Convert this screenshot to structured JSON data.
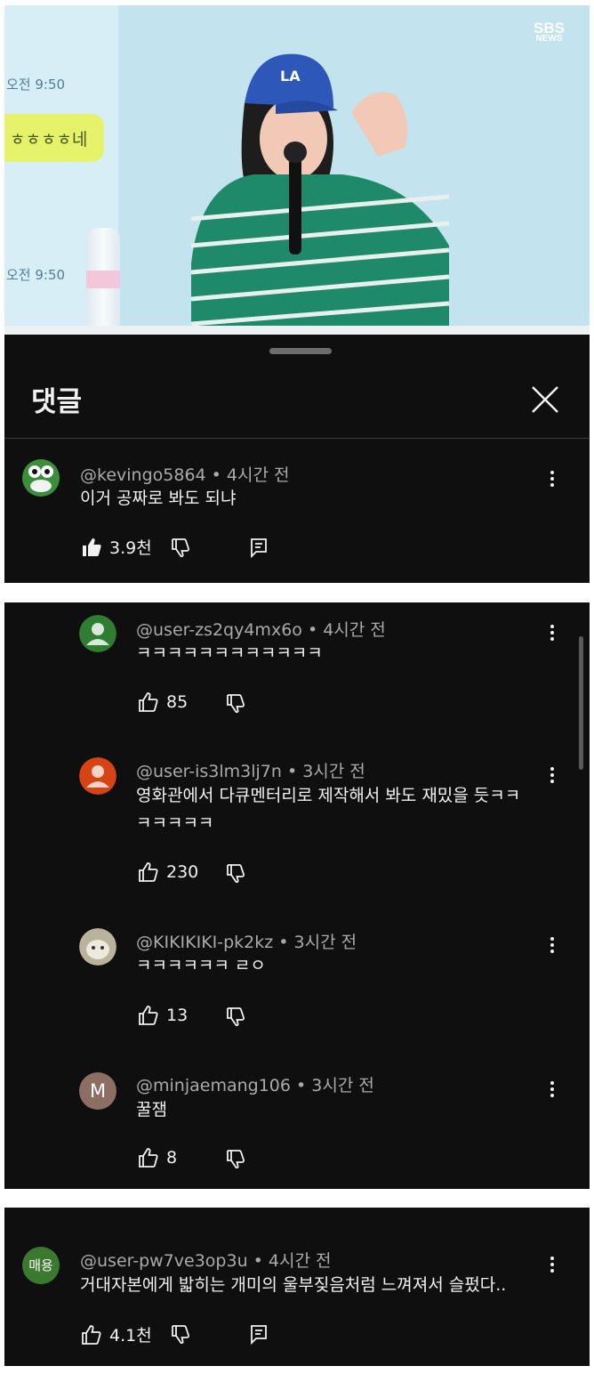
{
  "video": {
    "brand": "SBS",
    "brand_sub": "NEWS",
    "chat_time_1": "오전 9:50",
    "chat_bubble": "ㅎㅎㅎㅎ네",
    "chat_time_2": "오전 9:50"
  },
  "comments_panel": {
    "title": "댓글"
  },
  "top_comment": {
    "author": "@kevingo5864",
    "time": "4시간 전",
    "text": "이거 공짜로 봐도 되냐",
    "likes": "3.9천"
  },
  "replies": [
    {
      "author": "@user-zs2qy4mx6o",
      "time": "4시간 전",
      "text": "ㅋㅋㅋㅋㅋㅋㅋㅋㅋㅋㅋㅋ",
      "likes": "85",
      "avatar_color": "#2e7d32"
    },
    {
      "author": "@user-is3lm3lj7n",
      "time": "3시간 전",
      "text": "영화관에서 다큐멘터리로 제작해서 봐도 재밌을 듯ㅋㅋ ㅋㅋㅋㅋㅋ",
      "likes": "230",
      "avatar_color": "#d84315"
    },
    {
      "author": "@KIKIKIKI-pk2kz",
      "time": "3시간 전",
      "text": "ㅋㅋㅋㅋㅋㅋ ㄹㅇ",
      "likes": "13",
      "avatar_color": "#c9c2a3"
    },
    {
      "author": "@minjaemang106",
      "time": "3시간 전",
      "text": "꿀잼",
      "likes": "8",
      "avatar_color": "#8d6e63",
      "avatar_letter": "M"
    }
  ],
  "bottom_comment": {
    "author": "@user-pw7ve3op3u",
    "time": "4시간 전",
    "text": "거대자본에게 밟히는 개미의 울부짖음처럼 느껴져서 슬펐다..",
    "likes": "4.1천",
    "avatar_text": "매용",
    "avatar_color": "#3b7a2e"
  }
}
